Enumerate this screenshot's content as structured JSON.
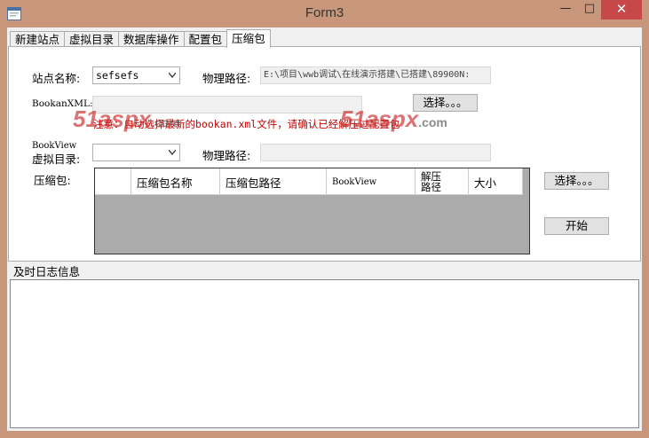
{
  "window": {
    "title": "Form3",
    "controls": {
      "minimize": "—",
      "maximize": "□",
      "close": "✕"
    }
  },
  "tabs": [
    {
      "label": "新建站点",
      "active": false
    },
    {
      "label": "虚拟目录",
      "active": false
    },
    {
      "label": "数据库操作",
      "active": false
    },
    {
      "label": "配置包",
      "active": false
    },
    {
      "label": "压缩包",
      "active": true
    }
  ],
  "form": {
    "site_name_label": "站点名称:",
    "site_name_value": "sefsefs",
    "physical_path_label": "物理路径:",
    "physical_path_value": "E:\\项目\\wwb调试\\在线演示搭建\\已搭建\\89900N:",
    "bookan_xml_label": "BookanXML:",
    "bookan_xml_value": "",
    "select_button_1": "选择。。。",
    "warning": "注意：自动选择最新的bookan.xml文件，请确认已经解压过配置包",
    "bookview_label_line1": "BookView",
    "bookview_label_line2": "虚拟目录:",
    "bookview_value": "",
    "physical_path_label_2": "物理路径:",
    "physical_path_value_2": "",
    "package_label": "压缩包:",
    "select_button_2": "选择。。。",
    "start_button": "开始"
  },
  "grid": {
    "columns": [
      {
        "label": ""
      },
      {
        "label": "压缩包名称"
      },
      {
        "label": "压缩包路径"
      },
      {
        "label": "BookView"
      },
      {
        "label": "解压\n路径"
      },
      {
        "label": "大小"
      }
    ],
    "rows": []
  },
  "log": {
    "label": "及时日志信息",
    "content": ""
  },
  "watermark": {
    "text": "51aspx",
    "suffix": ".com"
  },
  "colors": {
    "frame": "#c8967a",
    "close_button": "#c74848",
    "warning_text": "#c00000",
    "grid_background": "#ababab"
  }
}
